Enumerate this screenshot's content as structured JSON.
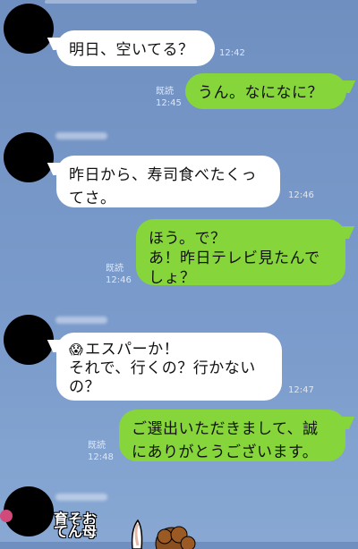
{
  "messages": [
    {
      "id": "m1",
      "side": "in",
      "lines": [
        "明日、空いてる？"
      ],
      "time": "12:42"
    },
    {
      "id": "m2",
      "side": "out",
      "lines": [
        "うん。なになに？"
      ],
      "read": "既読",
      "time": "12:45"
    },
    {
      "id": "m3",
      "side": "in",
      "lines": [
        "昨日から、寿司食べたくっ",
        "てさ。"
      ],
      "time": "12:46"
    },
    {
      "id": "m4",
      "side": "out",
      "lines": [
        "ほう。で？",
        "あ！昨日テレビ見たんで",
        "しょ？"
      ],
      "read": "既読",
      "time": "12:46"
    },
    {
      "id": "m5",
      "side": "in",
      "lines": [
        "エスパーか！",
        "それで、行くの？行かない",
        "の？"
      ],
      "emoji": "😱",
      "time": "12:47"
    },
    {
      "id": "m6",
      "side": "out",
      "lines": [
        "ご選出いただきまして、誠",
        "にありがとうございます。"
      ],
      "read": "既読",
      "time": "12:48"
    }
  ],
  "sticker": {
    "text_line1": "育そお",
    "text_line2": "てん母"
  }
}
